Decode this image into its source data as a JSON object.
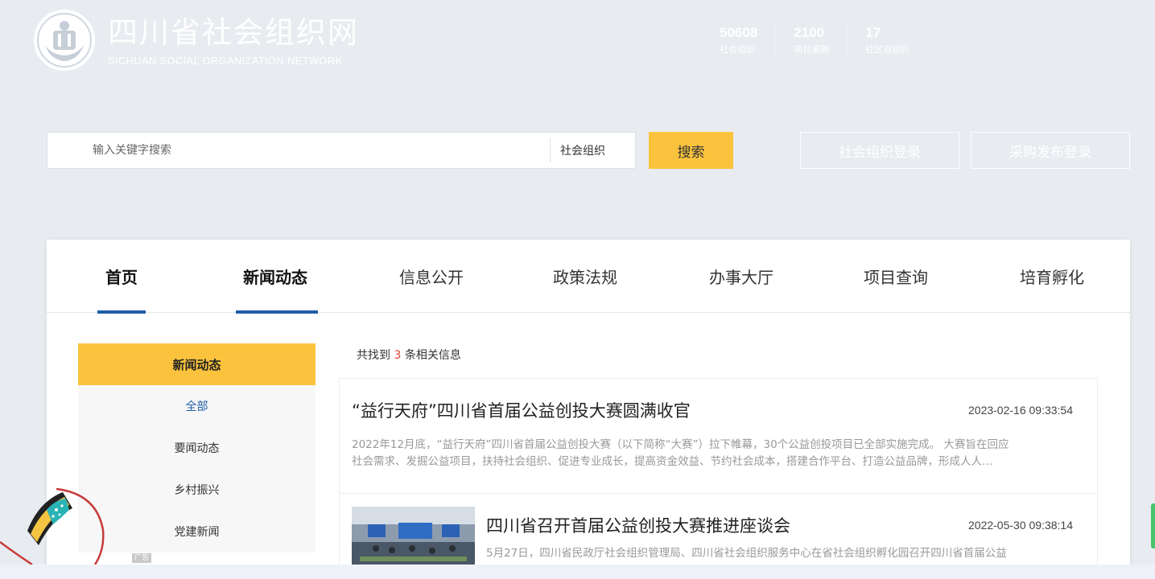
{
  "header": {
    "title": "四川省社会组织网",
    "subtitle": "SICHUAN SOCIAL ORGANIZATION NETWORK",
    "stats": [
      {
        "value": "50608",
        "label": "社会组织"
      },
      {
        "value": "2100",
        "label": "项目采购"
      },
      {
        "value": "17",
        "label": "社区自组织"
      }
    ]
  },
  "search": {
    "placeholder": "输入关键字搜索",
    "type": "社会组织",
    "button": "搜索"
  },
  "login": {
    "org_login": "社会组织登录",
    "purchase_login": "采购发布登录"
  },
  "nav": {
    "items": [
      "首页",
      "新闻动态",
      "信息公开",
      "政策法规",
      "办事大厅",
      "项目查询",
      "培育孵化"
    ]
  },
  "sidebar": {
    "heading": "新闻动态",
    "items": [
      "全部",
      "要闻动态",
      "乡村振兴",
      "党建新闻"
    ],
    "ad_tag": "广告"
  },
  "results": {
    "prefix": "共找到",
    "count": "3",
    "suffix": "条相关信息"
  },
  "news": [
    {
      "title": "“益行天府”四川省首届公益创投大赛圆满收官",
      "date": "2023-02-16 09:33:54",
      "desc_line1": "2022年12月底，“益行天府”四川省首届公益创投大赛（以下简称“大赛”）拉下帷幕，30个公益创投项目已全部实施完成。 大赛旨在回应",
      "desc_line2": "社会需求、发掘公益项目，扶持社会组织、促进专业成长，提高资金效益、节约社会成本，搭建合作平台、打造公益品牌，形成人人…"
    },
    {
      "title": "四川省召开首届公益创投大赛推进座谈会",
      "date": "2022-05-30 09:38:14",
      "desc_line1": "5月27日，四川省民政厅社会组织管理局、四川省社会组织服务中心在省社会组织孵化园召开四川省首届公益"
    }
  ],
  "colors": {
    "accent_yellow": "#fbc33d",
    "nav_underline": "#1f5ea8",
    "count_red": "#e0493a"
  }
}
